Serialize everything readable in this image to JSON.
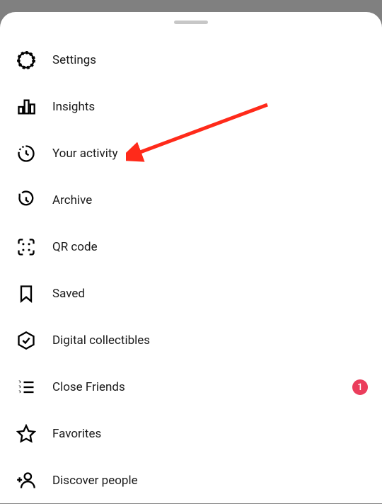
{
  "menu": {
    "items": [
      {
        "label": "Settings",
        "icon": "gear-icon",
        "badge": null
      },
      {
        "label": "Insights",
        "icon": "insights-icon",
        "badge": null
      },
      {
        "label": "Your activity",
        "icon": "activity-icon",
        "badge": null
      },
      {
        "label": "Archive",
        "icon": "archive-icon",
        "badge": null
      },
      {
        "label": "QR code",
        "icon": "qr-icon",
        "badge": null
      },
      {
        "label": "Saved",
        "icon": "saved-icon",
        "badge": null
      },
      {
        "label": "Digital collectibles",
        "icon": "collectibles-icon",
        "badge": null
      },
      {
        "label": "Close Friends",
        "icon": "close-friends-icon",
        "badge": "1"
      },
      {
        "label": "Favorites",
        "icon": "favorites-icon",
        "badge": null
      },
      {
        "label": "Discover people",
        "icon": "discover-people-icon",
        "badge": null
      }
    ]
  },
  "annotation": {
    "type": "arrow",
    "target_item_index": 2,
    "color": "#ff2a1a"
  }
}
